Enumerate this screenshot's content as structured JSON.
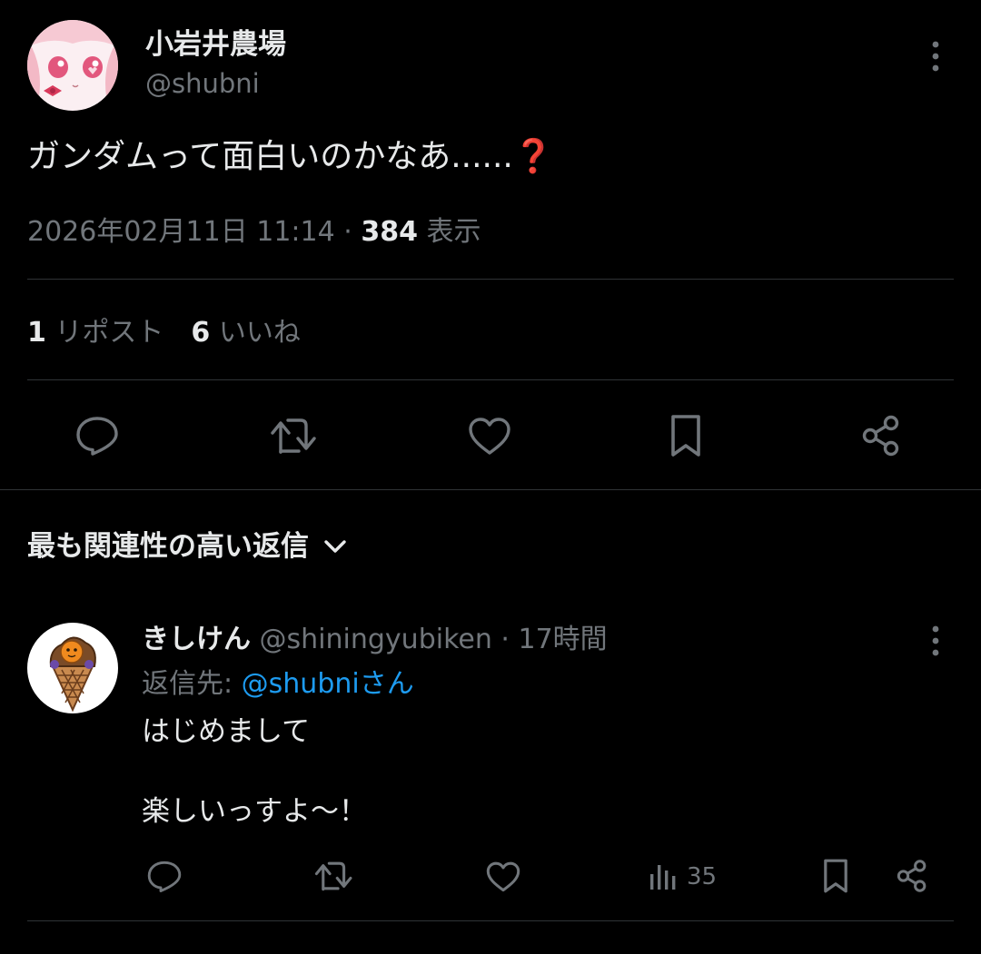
{
  "main_tweet": {
    "author": {
      "display_name": "小岩井農場",
      "handle": "@shubni"
    },
    "text": "ガンダムって面白いのかなあ......",
    "emoji": "❓",
    "timestamp": "2026年02月11日 11:14",
    "separator": "·",
    "views_count": "384",
    "views_label": "表示",
    "reposts_count": "1",
    "reposts_label": "リポスト",
    "likes_count": "6",
    "likes_label": "いいね",
    "actions": [
      "reply-icon",
      "repost-icon",
      "like-icon",
      "bookmark-icon",
      "share-icon"
    ]
  },
  "replies_header": {
    "label": "最も関連性の高い返信"
  },
  "reply": {
    "display_name": "きしけん",
    "handle": "@shiningyubiken",
    "separator": "·",
    "time": "17時間",
    "reply_to_label": "返信先: ",
    "reply_to_mention": "@shubniさん",
    "lines": [
      "はじめまして",
      "楽しいっすよ〜！"
    ],
    "views_count": "35",
    "actions": [
      "reply-icon",
      "repost-icon",
      "like-icon",
      "views-icon",
      "bookmark-icon",
      "share-icon"
    ]
  },
  "colors": {
    "background": "#000000",
    "text_primary": "#e7e9ea",
    "text_secondary": "#71767b",
    "divider": "#2f3336",
    "link": "#1d9bf0"
  }
}
